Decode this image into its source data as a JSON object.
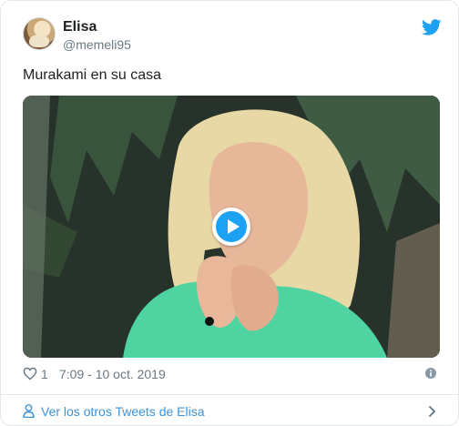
{
  "author": {
    "name": "Elisa",
    "handle": "@memeli95"
  },
  "tweet": {
    "text": "Murakami en su casa"
  },
  "media": {
    "type": "gif",
    "play_icon": "play-icon"
  },
  "actions": {
    "like_count": "1",
    "timestamp": "7:09 - 10 oct. 2019"
  },
  "footer": {
    "link_label": "Ver los otros Tweets de Elisa"
  },
  "colors": {
    "twitter_blue": "#1da1f2",
    "link_blue": "#3b94d9",
    "secondary_text": "#697882"
  },
  "icons": [
    "twitter-bird-icon",
    "heart-icon",
    "info-icon",
    "person-icon",
    "chevron-right-icon",
    "play-icon"
  ]
}
